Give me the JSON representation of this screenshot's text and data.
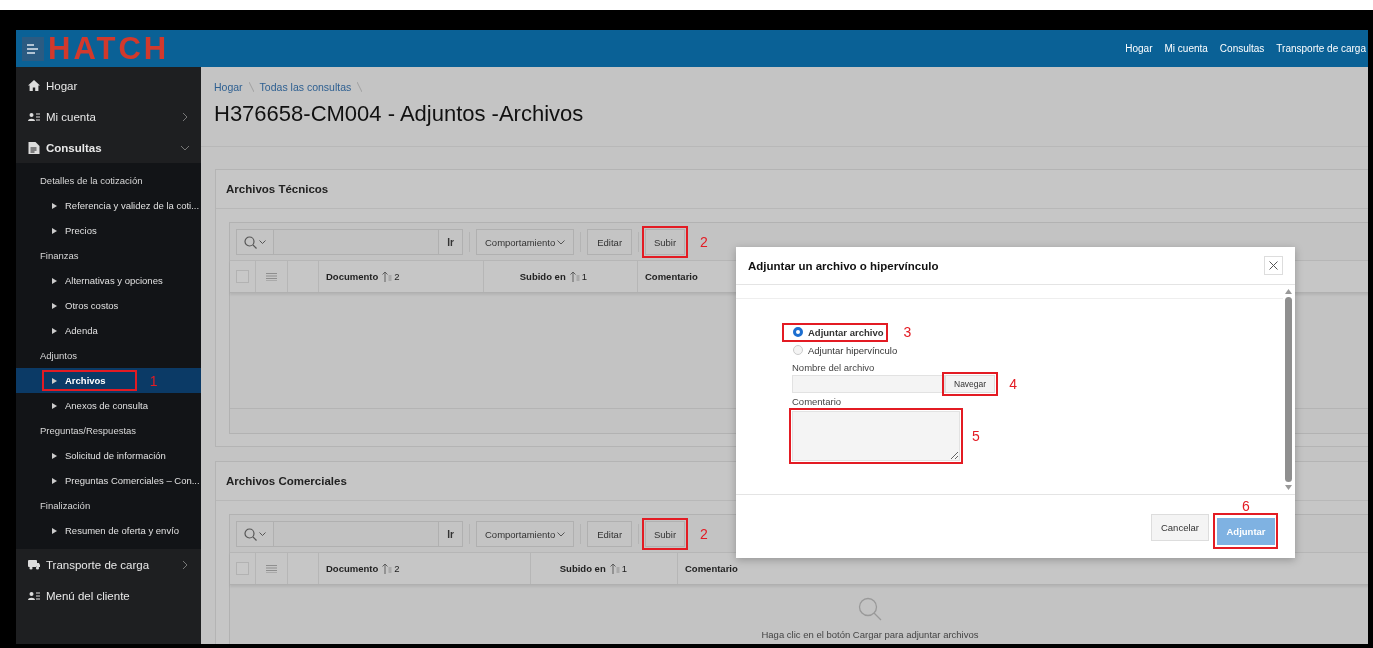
{
  "header": {
    "logo": "HATCH",
    "nav": [
      "Hogar",
      "Mi cuenta",
      "Consultas",
      "Transporte de carga"
    ]
  },
  "sidebar": {
    "items": [
      {
        "label": "Hogar",
        "kind": "home"
      },
      {
        "label": "Mi cuenta",
        "kind": "account",
        "expanded": false
      },
      {
        "label": "Consultas",
        "kind": "document",
        "expanded": true,
        "children": [
          {
            "label": "Detalles de la cotización",
            "children": [
              {
                "label": "Referencia y validez de la coti...",
                "selected": false
              },
              {
                "label": "Precios",
                "selected": false
              }
            ]
          },
          {
            "label": "Finanzas",
            "children": [
              {
                "label": "Alternativas y opciones",
                "selected": false
              },
              {
                "label": "Otros costos",
                "selected": false
              },
              {
                "label": "Adenda",
                "selected": false
              }
            ]
          },
          {
            "label": "Adjuntos",
            "children": [
              {
                "label": "Archivos",
                "selected": true,
                "callout": "1"
              },
              {
                "label": "Anexos de consulta",
                "selected": false
              }
            ]
          },
          {
            "label": "Preguntas/Respuestas",
            "children": [
              {
                "label": "Solicitud de información",
                "selected": false
              },
              {
                "label": "Preguntas Comerciales – Con...",
                "selected": false
              }
            ]
          },
          {
            "label": "Finalización",
            "children": [
              {
                "label": "Resumen de oferta y envío",
                "selected": false
              }
            ]
          }
        ]
      },
      {
        "label": "Transporte de carga",
        "kind": "vehicle",
        "expanded": false
      },
      {
        "label": "Menú del cliente",
        "kind": "account"
      }
    ]
  },
  "breadcrumb": [
    "Hogar",
    "Todas las consultas"
  ],
  "title": "H376658-CM004 - Adjuntos -Archivos",
  "regions": [
    {
      "title": "Archivos Técnicos",
      "all_checked": false,
      "toolbar": {
        "go": "Ir",
        "actions": "Comportamiento",
        "edit": "Editar",
        "upload": "Subir",
        "upload_callout": "2"
      },
      "columns": [
        {
          "label": "Documento",
          "sort": "2"
        },
        {
          "label": "Subido en",
          "sort": "1"
        },
        {
          "label": "Comentario"
        }
      ]
    },
    {
      "title": "Archivos Comerciales",
      "all_checked": false,
      "toolbar": {
        "go": "Ir",
        "actions": "Comportamiento",
        "edit": "Editar",
        "upload": "Subir",
        "upload_callout": "2"
      },
      "columns": [
        {
          "label": "Documento",
          "sort": "2"
        },
        {
          "label": "Subido en",
          "sort": "1"
        },
        {
          "label": "Comentario"
        }
      ],
      "empty_message": "Haga clic en el botón Cargar para adjuntar archivos"
    }
  ],
  "dialog": {
    "title": "Adjuntar un archivo o hipervínculo",
    "options": [
      {
        "label": "Adjuntar archivo",
        "selected": true,
        "callout": "3"
      },
      {
        "label": "Adjuntar hipervínculo",
        "selected": false
      }
    ],
    "file_label": "Nombre del archivo",
    "browse": "Navegar",
    "browse_callout": "4",
    "comment_label": "Comentario",
    "comment_callout": "5",
    "cancel": "Cancelar",
    "submit": "Adjuntar",
    "submit_callout": "6"
  }
}
